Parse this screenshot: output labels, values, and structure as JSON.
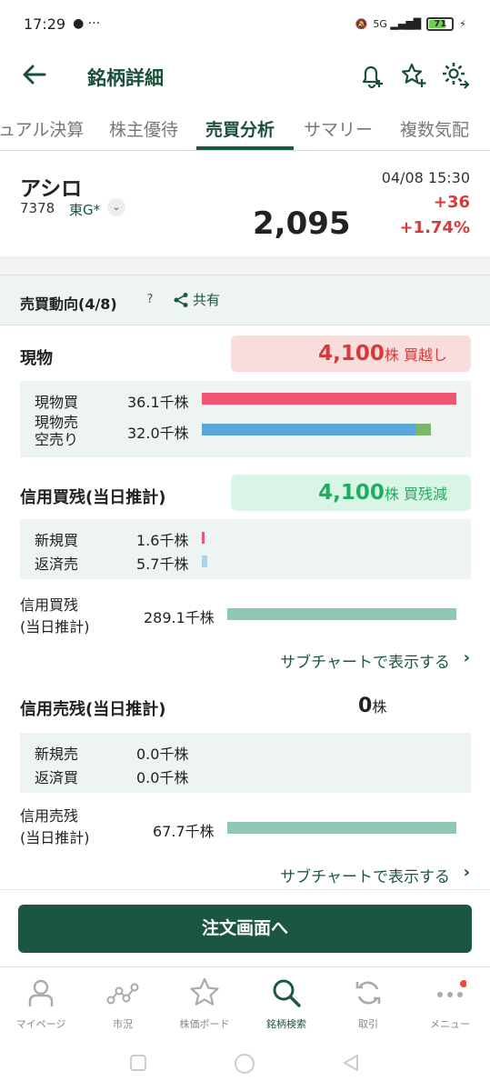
{
  "status": {
    "time": "17:29",
    "battery": "71"
  },
  "header": {
    "title": "銘柄詳細"
  },
  "tabs": [
    "ュアル決算",
    "株主優待",
    "売買分析",
    "サマリー",
    "複数気配"
  ],
  "stock": {
    "name": "アシロ",
    "code": "7378",
    "market": "東G*",
    "time": "04/08 15:30",
    "price": "2,095",
    "change": "+36",
    "change_pct": "+1.74%"
  },
  "trend": {
    "title": "売買動向(4/8)",
    "help": "?",
    "share": "共有"
  },
  "genbutsu": {
    "title": "現物",
    "net_value": "4,100",
    "net_unit": "株",
    "net_label": "買越し",
    "rows": [
      {
        "label": "現物買",
        "value": "36.1千株",
        "ratio": 1.0
      },
      {
        "label": "現物売\n空売り",
        "value": "32.0千株",
        "ratio_sell": 0.84,
        "ratio_short": 0.06
      }
    ]
  },
  "margin_buy": {
    "title": "信用買残(当日推計)",
    "net_value": "4,100",
    "net_unit": "株",
    "net_label": "買残減",
    "rows": [
      {
        "label": "新規買",
        "value": "1.6千株"
      },
      {
        "label": "返済売",
        "value": "5.7千株"
      }
    ],
    "total_label1": "信用買残",
    "total_label2": "(当日推計)",
    "total_value": "289.1千株",
    "link": "サブチャートで表示する"
  },
  "margin_sell": {
    "title": "信用売残(当日推計)",
    "net_value": "0",
    "net_unit": "株",
    "rows": [
      {
        "label": "新規売",
        "value": "0.0千株"
      },
      {
        "label": "返済買",
        "value": "0.0千株"
      }
    ],
    "total_label1": "信用売残",
    "total_label2": "(当日推計)",
    "total_value": "67.7千株",
    "link": "サブチャートで表示する"
  },
  "order_button": "注文画面へ",
  "nav": [
    {
      "label": "マイページ",
      "icon": "person-icon"
    },
    {
      "label": "市況",
      "icon": "market-icon"
    },
    {
      "label": "株価ボード",
      "icon": "star-icon"
    },
    {
      "label": "銘柄検索",
      "icon": "search-icon"
    },
    {
      "label": "取引",
      "icon": "refresh-icon"
    },
    {
      "label": "メニュー",
      "icon": "more-icon"
    }
  ],
  "colors": {
    "brand": "#1b5644",
    "buy": "#ef5470",
    "sell": "#5aa6d6",
    "short": "#7cb86a",
    "margin_total": "#8fc7b4",
    "up": "#d63a3a",
    "green_badge": "#1fae5e"
  }
}
